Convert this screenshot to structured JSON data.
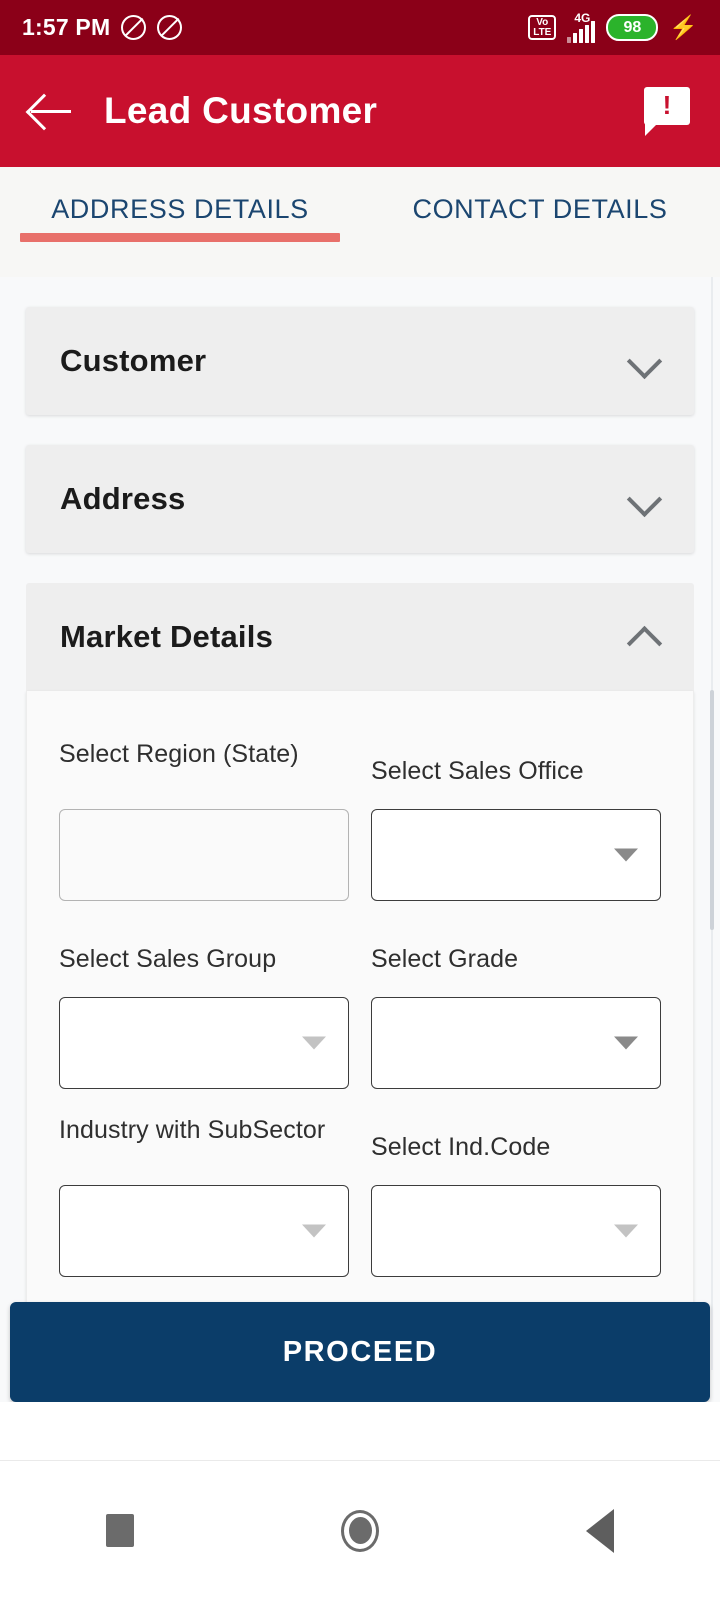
{
  "status_bar": {
    "time": "1:57 PM",
    "icons": [
      "mute-icon",
      "mute-icon"
    ],
    "volte_label_top": "Vo",
    "volte_label_bottom": "LTE",
    "network": "4G",
    "battery_percent": "98",
    "charging": true
  },
  "app_bar": {
    "back_icon": "back-arrow-icon",
    "title": "Lead Customer",
    "action_icon": "feedback-icon",
    "background_color": "#C8102E"
  },
  "tabs": {
    "active_index": 0,
    "items": [
      {
        "label": "ADDRESS DETAILS"
      },
      {
        "label": "CONTACT DETAILS"
      }
    ],
    "indicator_color": "#E8706A",
    "text_color": "#1B4670"
  },
  "sections": [
    {
      "title": "Customer",
      "expanded": false
    },
    {
      "title": "Address",
      "expanded": false
    },
    {
      "title": "Market Details",
      "expanded": true
    }
  ],
  "market_details": {
    "rows": [
      [
        {
          "label": "Select Region (State)",
          "value": "",
          "disabled": true,
          "has_arrow": false,
          "arrow_light": false
        },
        {
          "label": "Select Sales Office",
          "value": "",
          "disabled": false,
          "has_arrow": true,
          "arrow_light": false
        }
      ],
      [
        {
          "label": "Select Sales Group",
          "value": "",
          "disabled": false,
          "has_arrow": true,
          "arrow_light": true
        },
        {
          "label": "Select Grade",
          "value": "",
          "disabled": false,
          "has_arrow": true,
          "arrow_light": false
        }
      ],
      [
        {
          "label": "Industry with SubSector",
          "value": "",
          "disabled": false,
          "has_arrow": true,
          "arrow_light": true
        },
        {
          "label": "Select Ind.Code",
          "value": "",
          "disabled": false,
          "has_arrow": true,
          "arrow_light": true
        }
      ]
    ]
  },
  "primary_action": {
    "label": "PROCEED",
    "color": "#0B3D69"
  },
  "nav_bar": {
    "recents_icon": "square-recents-icon",
    "home_icon": "circle-home-icon",
    "back_icon": "triangle-back-icon"
  }
}
